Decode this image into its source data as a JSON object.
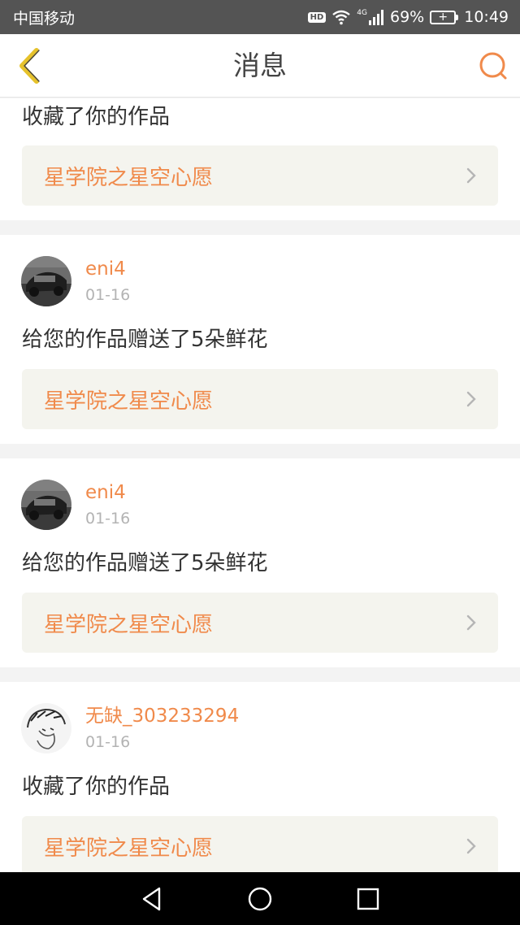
{
  "status_bar": {
    "carrier": "中国移动",
    "hd_badge": "HD",
    "network": "4G",
    "battery_percent": "69%",
    "time": "10:49"
  },
  "header": {
    "title": "消息",
    "back_icon": "back-chevron-icon",
    "search_icon": "search-icon"
  },
  "colors": {
    "accent": "#f08a4b",
    "back_icon": "#e6c22b",
    "status_bar": "#545454",
    "link_bg": "#f4f4ee"
  },
  "messages": [
    {
      "action": "收藏了你的作品",
      "work_title": "星学院之星空心愿"
    },
    {
      "username": "eni4",
      "date": "01-16",
      "action": "给您的作品赠送了5朵鲜花",
      "work_title": "星学院之星空心愿"
    },
    {
      "username": "eni4",
      "date": "01-16",
      "action": "给您的作品赠送了5朵鲜花",
      "work_title": "星学院之星空心愿"
    },
    {
      "username": "无缺_303233294",
      "date": "01-16",
      "action": "收藏了你的作品",
      "work_title": "星学院之星空心愿"
    }
  ],
  "nav_bar": [
    "back-triangle-icon",
    "home-circle-icon",
    "recents-square-icon"
  ]
}
